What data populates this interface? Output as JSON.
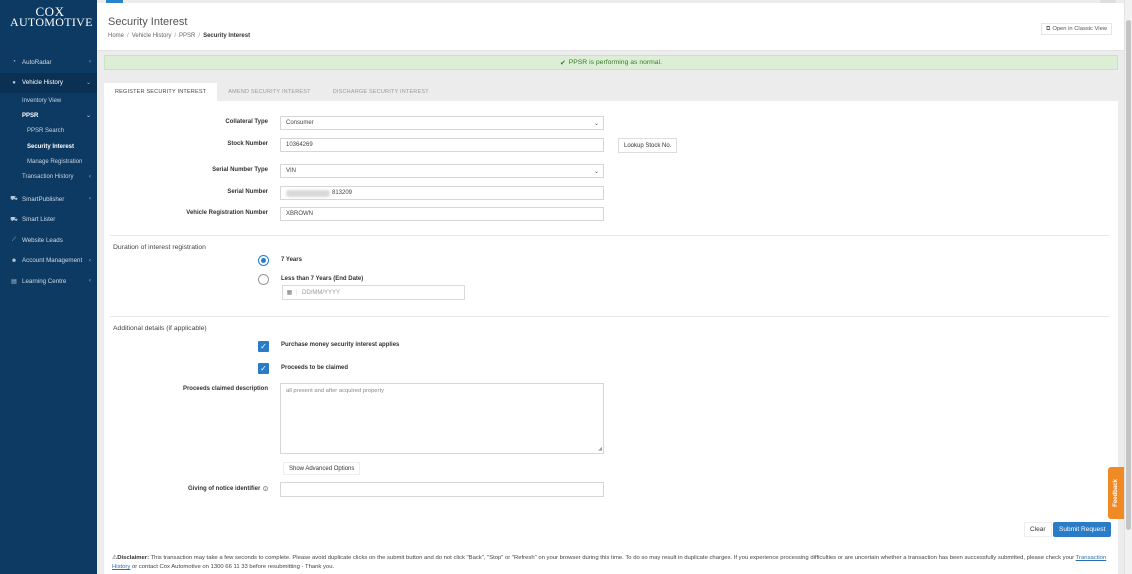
{
  "sidebar": {
    "logo_line1": "COX",
    "logo_line2": "AUTOMOTIVE",
    "items": [
      {
        "label": "AutoRadar",
        "icon": "gauge-icon"
      },
      {
        "label": "Vehicle History",
        "icon": "dot-icon"
      },
      {
        "label": "SmartPublisher",
        "icon": "car-icon"
      },
      {
        "label": "Smart Lister",
        "icon": "car-icon"
      },
      {
        "label": "Website Leads",
        "icon": "chart-line-icon"
      },
      {
        "label": "Account Management",
        "icon": "user-icon"
      },
      {
        "label": "Learning Centre",
        "icon": "document-icon"
      }
    ],
    "sub": {
      "inventory_view": "Inventory View",
      "ppsr": "PPSR",
      "ppsr_search": "PPSR Search",
      "security_interest": "Security Interest",
      "manage_registration": "Manage Registration",
      "transaction_history": "Transaction History"
    }
  },
  "header": {
    "title": "Security Interest",
    "breadcrumb": [
      "Home",
      "Vehicle History",
      "PPSR",
      "Security Interest"
    ],
    "classic_view": "Open in Classic View"
  },
  "alert": "PPSR is performing as normal.",
  "tabs": [
    "REGISTER SECURITY INTEREST",
    "AMEND SECURITY INTEREST",
    "DISCHARGE SECURITY INTEREST"
  ],
  "form": {
    "collateral_type_label": "Collateral Type",
    "collateral_type_value": "Consumer",
    "stock_number_label": "Stock Number",
    "stock_number_value": "10364269",
    "lookup_button": "Lookup Stock No.",
    "serial_type_label": "Serial Number Type",
    "serial_type_value": "VIN",
    "serial_number_label": "Serial Number",
    "serial_number_visible": "813209",
    "rego_label": "Vehicle Registration Number",
    "rego_value": "XBROWN"
  },
  "duration": {
    "title": "Duration of interest registration",
    "option1": "7 Years",
    "option2": "Less than 7 Years (End Date)",
    "date_placeholder": "DD/MM/YYYY"
  },
  "additional": {
    "title": "Additional details (if applicable)",
    "pmsi": "Purchase money security interest applies",
    "proceeds": "Proceeds to be claimed",
    "proceeds_desc_label": "Proceeds claimed description",
    "proceeds_desc_placeholder": "all present and after acquired property",
    "advanced_button": "Show Advanced Options",
    "notice_label": "Giving of notice identifier"
  },
  "actions": {
    "clear": "Clear",
    "submit": "Submit Request"
  },
  "disclaimer": {
    "bold": "Disclaimer:",
    "text": " This transaction may take a few seconds to complete. Please avoid duplicate clicks on the submit button and do not click \"Back\", \"Stop\" or \"Refresh\" on your browser during this time. To do so may result in duplicate charges. If you experience processing difficulties or are uncertain whether a transaction has been successfully submitted, please check your",
    "link": "Transaction History",
    "text2": " or contact Cox Automotive on 1300 66 11 33 before resubmitting - Thank you."
  },
  "feedback": "Feedback",
  "colors": {
    "sidebar_bg": "#0d3a62",
    "primary": "#2a7cc6",
    "alert_bg": "#dcefd6",
    "feedback": "#f08a24"
  }
}
